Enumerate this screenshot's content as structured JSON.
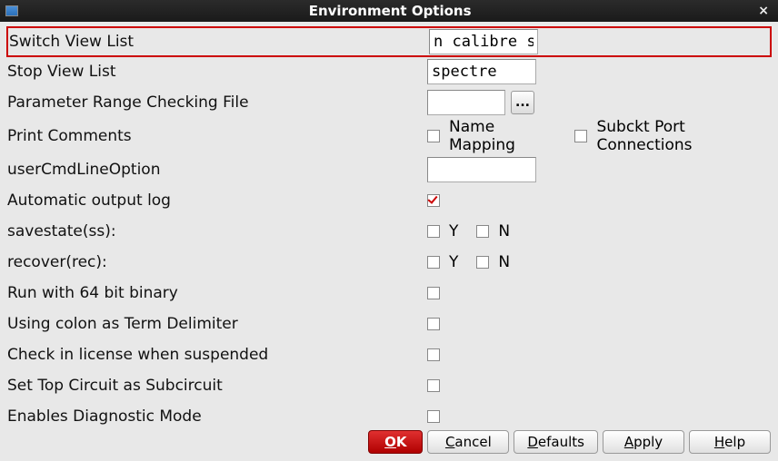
{
  "title": "Environment Options",
  "rows": {
    "switchView": {
      "label": "Switch View List",
      "value": "n calibre s"
    },
    "stopView": {
      "label": "Stop View List",
      "value": "spectre"
    },
    "paramFile": {
      "label": "Parameter Range Checking File",
      "value": "",
      "browse": "..."
    },
    "printComments": {
      "label": "Print Comments",
      "opt1": "Name Mapping",
      "opt2": "Subckt Port Connections"
    },
    "userCmd": {
      "label": "userCmdLineOption",
      "value": ""
    },
    "autoLog": {
      "label": "Automatic output log"
    },
    "savestate": {
      "label": "savestate(ss):",
      "y": "Y",
      "n": "N"
    },
    "recover": {
      "label": "recover(rec):",
      "y": "Y",
      "n": "N"
    },
    "run64": {
      "label": "Run with 64 bit binary"
    },
    "colonDelim": {
      "label": "Using colon as Term Delimiter"
    },
    "checkLic": {
      "label": "Check in license when suspended"
    },
    "setTop": {
      "label": "Set Top Circuit as Subcircuit"
    },
    "diag": {
      "label": "Enables Diagnostic Mode"
    }
  },
  "buttons": {
    "ok": {
      "pre": "",
      "u": "O",
      "post": "K"
    },
    "cancel": {
      "pre": "",
      "u": "C",
      "post": "ancel"
    },
    "defaults": {
      "pre": "",
      "u": "D",
      "post": "efaults"
    },
    "apply": {
      "pre": "",
      "u": "A",
      "post": "pply"
    },
    "help": {
      "pre": "",
      "u": "H",
      "post": "elp"
    }
  }
}
